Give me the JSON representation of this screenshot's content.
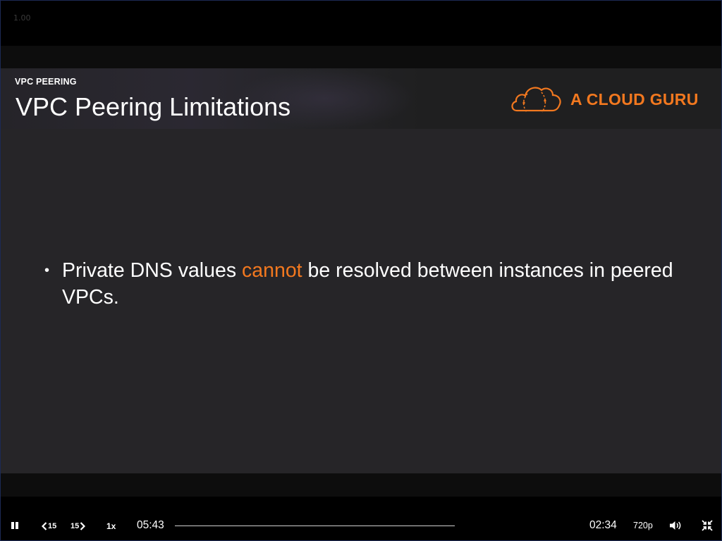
{
  "player": {
    "rate_overlay": "1.00",
    "elapsed": "05:43",
    "remaining": "02:34",
    "back_label": "15",
    "forward_label": "15",
    "speed_label": "1x",
    "quality_label": "720p",
    "progress_fraction": 0
  },
  "slide": {
    "section": "VPC PEERING",
    "title": "VPC Peering Limitations",
    "brand": "A CLOUD GURU",
    "brand_color": "#f2781f",
    "bullet_parts": {
      "before": "Private DNS values ",
      "highlight": "cannot",
      "after": " be resolved between instances in peered VPCs."
    }
  },
  "icons": {
    "pause": "pause-icon",
    "back": "rewind-15-icon",
    "forward": "forward-15-icon",
    "volume": "volume-icon",
    "exit_fullscreen": "exit-fullscreen-icon",
    "logo": "cloud-logo-icon"
  }
}
